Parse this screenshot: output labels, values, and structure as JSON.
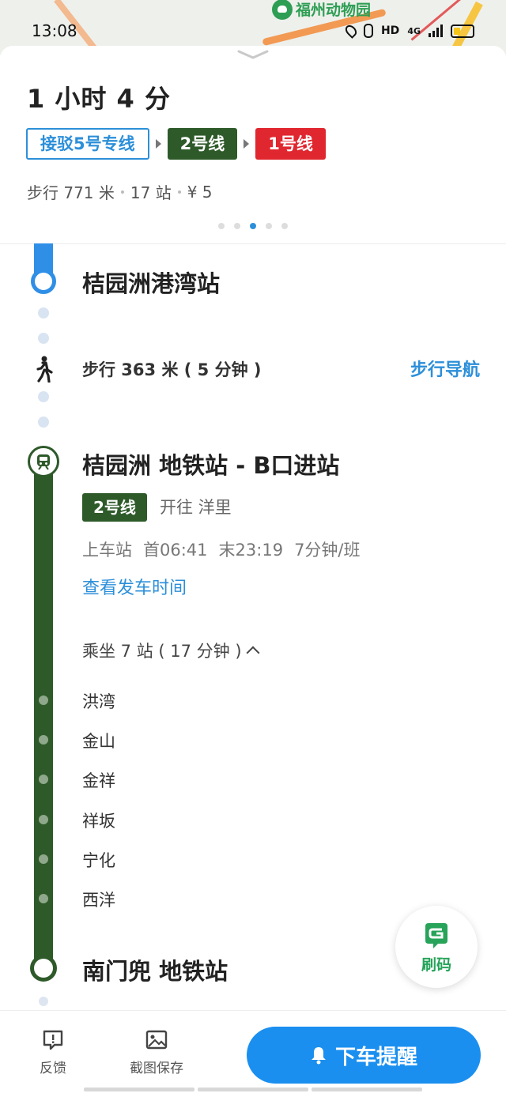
{
  "map": {
    "poi_label": "福州动物园"
  },
  "status_bar": {
    "time": "13:08",
    "hd_label": "HD",
    "net_label": "4G"
  },
  "summary": {
    "duration": "1 小时 4 分",
    "chips": [
      {
        "label": "接驳5号专线",
        "kind": "bus"
      },
      {
        "label": "2号线",
        "kind": "l2",
        "color": "#2e5a2a"
      },
      {
        "label": "1号线",
        "kind": "l1",
        "color": "#e0262f"
      }
    ],
    "walk": "步行 771 米",
    "stops": "17 站",
    "fare": "¥ 5"
  },
  "timeline": {
    "origin": "桔园洲港湾站",
    "walk_text": "步行 363 米 ( 5 分钟 )",
    "walk_nav": "步行导航",
    "board_station": "桔园洲 地铁站 - B口进站",
    "line_badge": "2号线",
    "toward": "开往 洋里",
    "board_label": "上车站",
    "first_train": "首06:41",
    "last_train": "末23:19",
    "headway": "7分钟/班",
    "check_time": "查看发车时间",
    "ride": "乘坐 7 站 ( 17 分钟 )",
    "stops": [
      "洪湾",
      "金山",
      "金祥",
      "祥坂",
      "宁化",
      "西洋"
    ],
    "alight_station": "南门兜 地铁站"
  },
  "fab": {
    "label": "刷码"
  },
  "bottom_bar": {
    "feedback": "反馈",
    "save_screenshot": "截图保存",
    "alert": "下车提醒"
  },
  "colors": {
    "accent": "#1a8ff0",
    "line2": "#2e5a2a",
    "line1": "#e0262f",
    "walk": "#2f8fe6"
  }
}
